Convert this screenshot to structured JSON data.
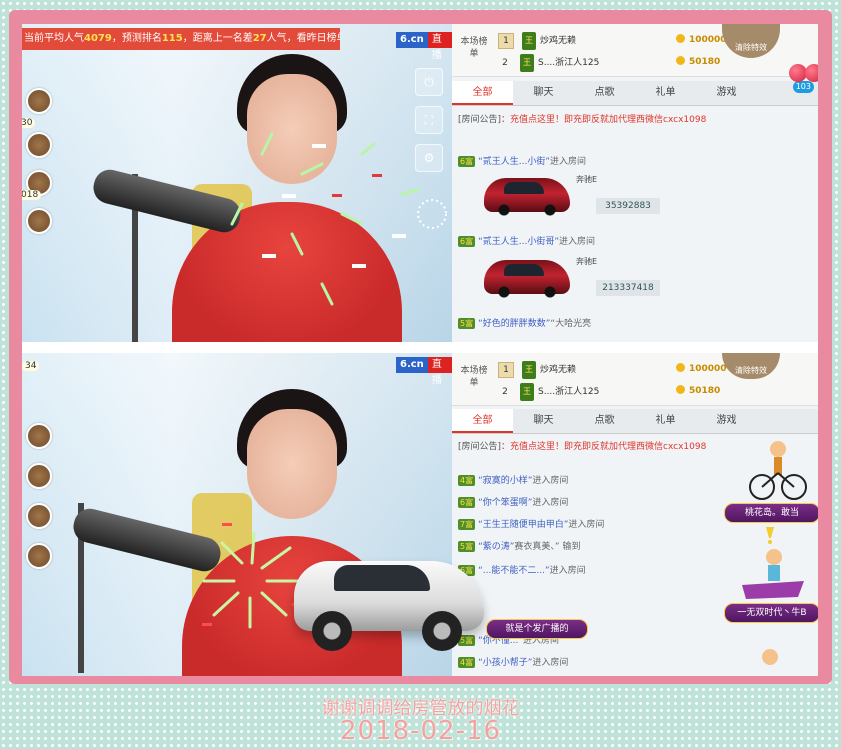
{
  "top": {
    "popularity_prefix": "当前平均人气",
    "popularity_value": "4079",
    "popularity_mid1": "，预测排名",
    "rank_value": "115",
    "popularity_mid2": "，距离上一名差",
    "gap_value": "27",
    "popularity_suffix": "人气，看昨日榜单",
    "site_logo": "6.cn",
    "live_badge": "直播",
    "side_buttons": [
      "关闭",
      "全屏"
    ],
    "fan_counts": [
      "30",
      "018"
    ],
    "clear_effects": "清除特效",
    "rank_label": "本场榜单",
    "ranks": [
      {
        "num": "1",
        "level": "王",
        "name": "炒鸡无赖",
        "coins": "100000"
      },
      {
        "num": "2",
        "level": "王",
        "name": "S....浙江人125",
        "coins": "50180"
      }
    ],
    "tabs": [
      "全部",
      "聊天",
      "点歌",
      "礼单",
      "游戏"
    ],
    "tab_badge": "103",
    "announce_label": "[房间公告]",
    "announce_text": "：充值点这里！即充即反就加代理西微信cxcx1098",
    "chats": [
      {
        "level": "6富",
        "name": "“贰王人生...小街”",
        "text": "进入房间"
      },
      {
        "level": "6富",
        "name": "“贰王人生...小街哥”",
        "text": "进入房间"
      },
      {
        "level": "5富",
        "name": "“好色的胖胖数数”",
        "text": "“大哈光亮"
      }
    ],
    "cars": [
      {
        "brand": "奔驰E",
        "id": "35392883"
      },
      {
        "brand": "奔驰E",
        "id": "213337418"
      }
    ]
  },
  "bottom": {
    "fan_count": "34",
    "site_logo": "6.cn",
    "live_badge": "直播",
    "clear_effects": "清除特效",
    "rank_label": "本场榜单",
    "ranks": [
      {
        "num": "1",
        "level": "王",
        "name": "炒鸡无赖",
        "coins": "100000"
      },
      {
        "num": "2",
        "level": "王",
        "name": "S....浙江人125",
        "coins": "50180"
      }
    ],
    "tabs": [
      "全部",
      "聊天",
      "点歌",
      "礼单",
      "游戏"
    ],
    "announce_label": "[房间公告]",
    "announce_text": "：充值点这里！即充即反就加代理西微信cxcx1098",
    "chats": [
      {
        "level": "4富",
        "name": "“寂寞的小样”",
        "text": "进入房间"
      },
      {
        "level": "6富",
        "name": "“你个笨蛋啊”",
        "text": "进入房间"
      },
      {
        "level": "7富",
        "name": "“王生王随便甲由甲白”",
        "text": "进入房间"
      },
      {
        "level": "5富",
        "name": "“紫の涛”",
        "text": "赛衣真美、” 输到"
      },
      {
        "level": "6富",
        "name": "“...能不能不二...”",
        "text": "进入房间"
      },
      {
        "level": "5富",
        "name": "“你不懂...”",
        "text": "进入房间"
      },
      {
        "level": "4富",
        "name": "“小孩小帮子”",
        "text": "进入房间"
      }
    ],
    "gift_labels": [
      "桃花岛。敢当",
      "一无双时代丶牛B"
    ],
    "gift_bubble": "就是个发广播的"
  },
  "caption": {
    "line1": "谢谢调调给房管放的烟花",
    "line2": "2018-02-16"
  },
  "colors": {
    "frame": "#e98aa0",
    "banner": "#e24a3a",
    "accent": "#e0352b",
    "background": "#bfe3d8"
  }
}
